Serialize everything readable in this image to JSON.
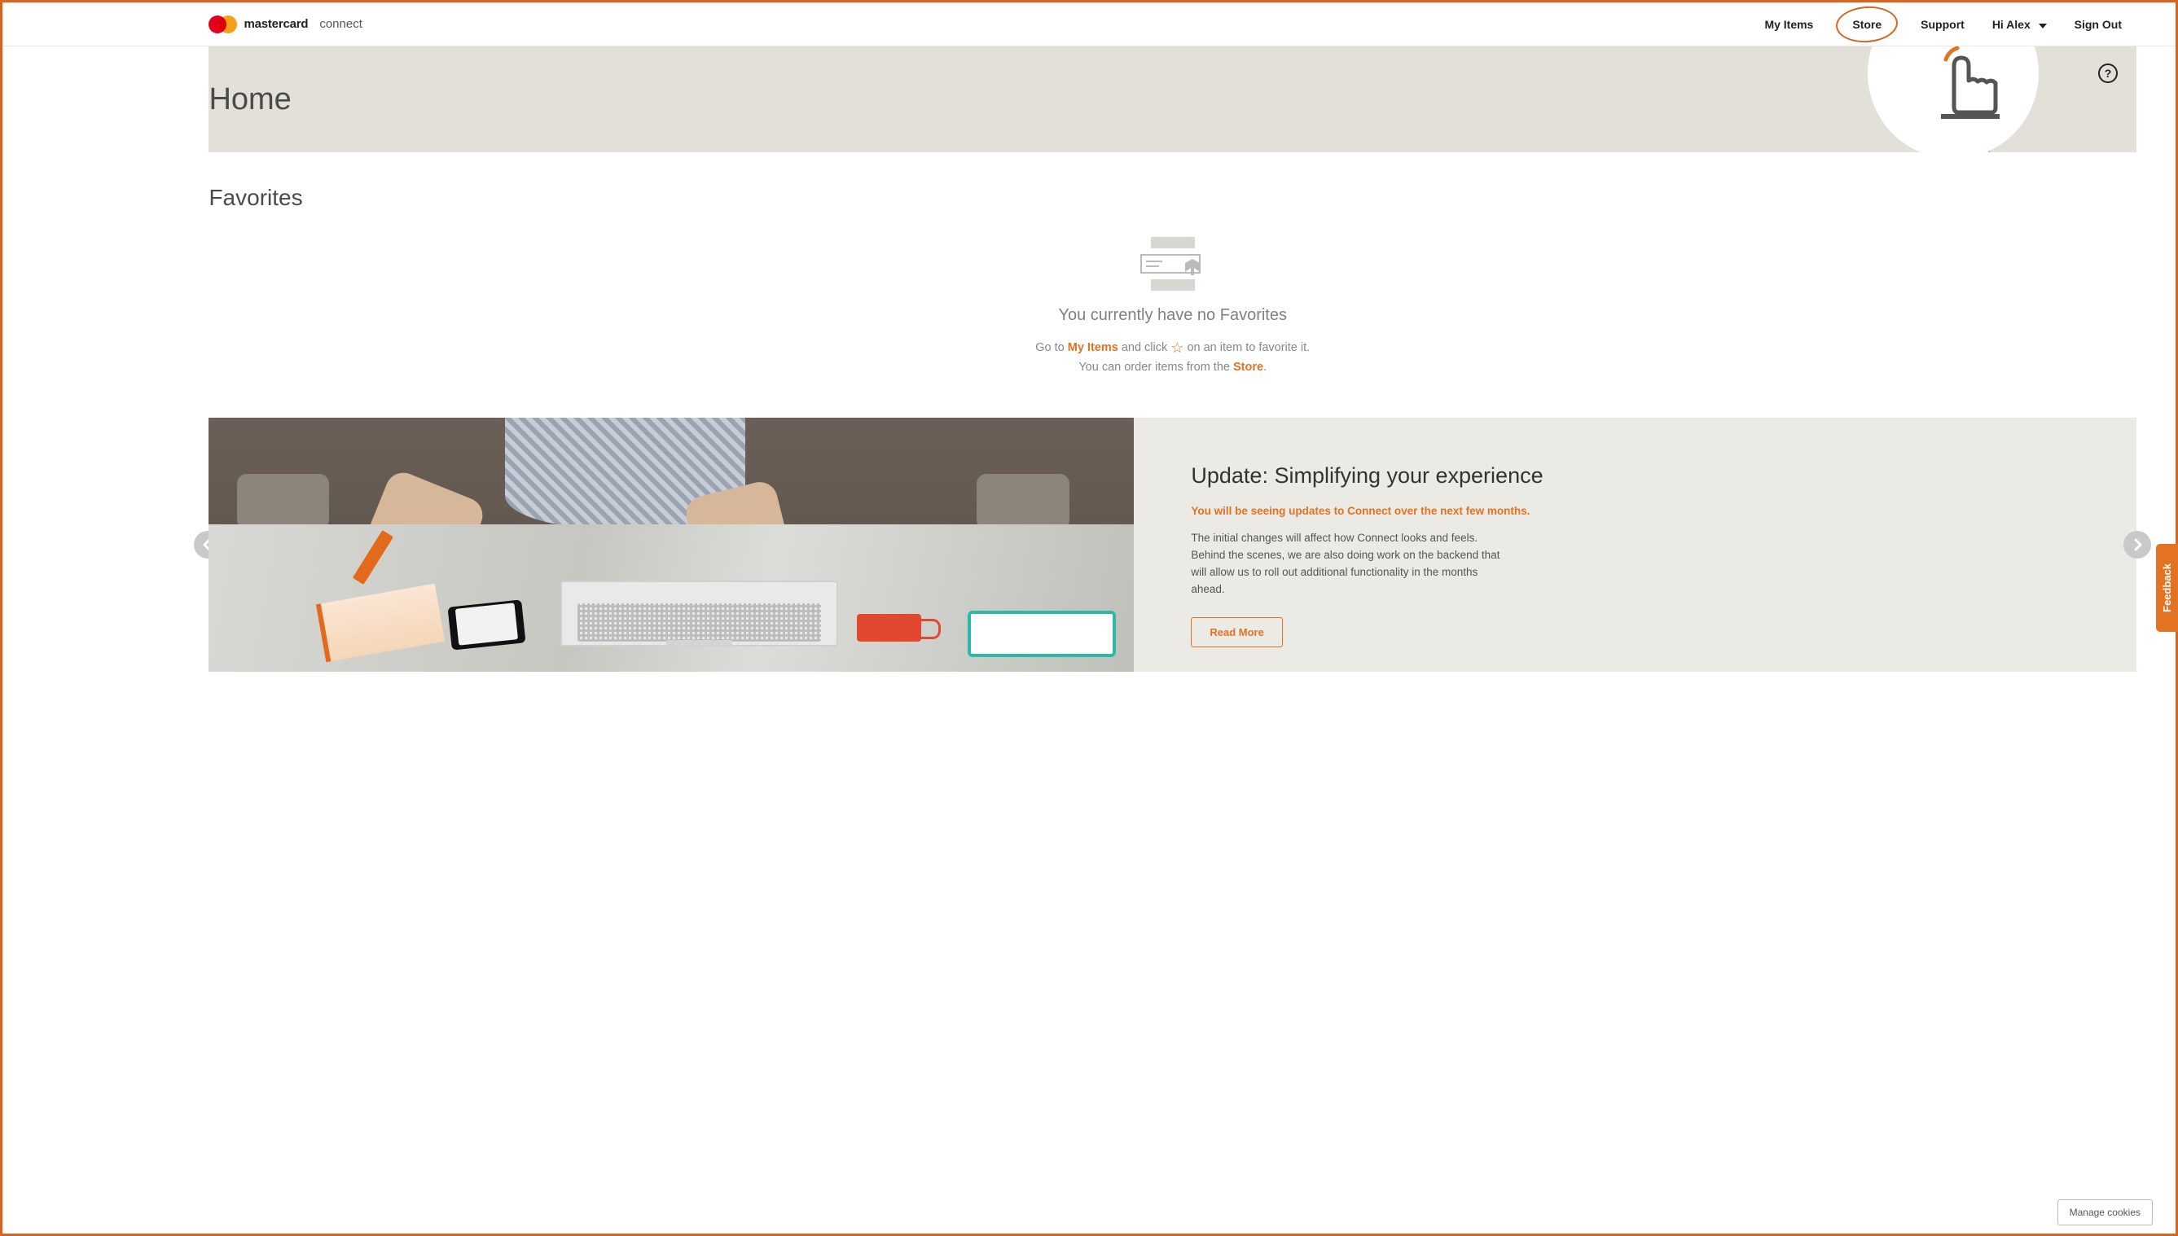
{
  "brand": {
    "name": "mastercard",
    "sub": "connect"
  },
  "nav": {
    "my_items": "My Items",
    "store": "Store",
    "support": "Support",
    "greeting": "Hi Alex",
    "sign_out": "Sign Out"
  },
  "hero": {
    "title": "Home"
  },
  "favorites": {
    "section_title": "Favorites",
    "empty_title": "You currently have no Favorites",
    "line1_a": "Go to ",
    "line1_link": "My Items",
    "line1_b": " and click ",
    "line1_c": " on an item to favorite it.",
    "line2_a": "You can order items from the ",
    "line2_link": "Store",
    "line2_b": "."
  },
  "carousel": {
    "title": "Update: Simplifying your experience",
    "subtitle": "You will be seeing updates to Connect over the next few months.",
    "body": "The initial changes will affect how Connect looks and feels. Behind the scenes, we are also doing work on the backend that will allow us to roll out additional functionality in the months ahead.",
    "read_more": "Read More"
  },
  "feedback": {
    "label": "Feedback"
  },
  "cookies": {
    "label": "Manage cookies"
  }
}
